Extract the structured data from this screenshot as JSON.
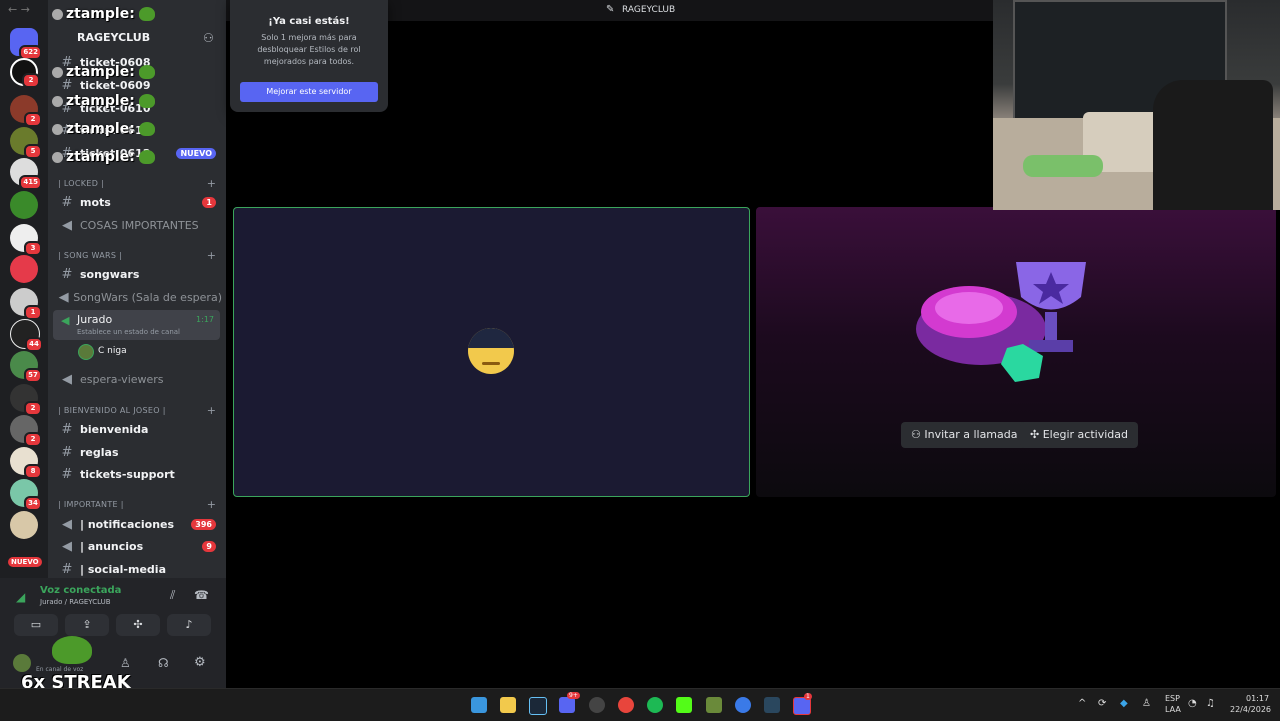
{
  "window": {
    "title": "RAGEYCLUB",
    "nav": "← →"
  },
  "server": {
    "name": "RAGEYCLUB"
  },
  "overlay": {
    "chat_user": "ztample:",
    "streak": "6x STREAK"
  },
  "channels_top": [
    {
      "name": "ticket-0608"
    },
    {
      "name": "ticket-0609"
    },
    {
      "name": "ticket-0610"
    },
    {
      "name": "ticket-0611"
    },
    {
      "name": "ticket-0612",
      "tag": "NUEVO"
    }
  ],
  "categories": {
    "locked": "| LOCKED |",
    "songwars": "| SONG WARS |",
    "bienvenida": "| BIENVENIDO AL JOSEO |",
    "importante": "| IMPORTANTE |"
  },
  "channels": {
    "mots": {
      "name": "mots",
      "badge": "1"
    },
    "cosas": {
      "name": "COSAS IMPORTANTES"
    },
    "songwars": {
      "name": "songwars"
    },
    "songwars_wait": {
      "name": "SongWars (Sala de espera)"
    },
    "jurado": {
      "name": "Jurado",
      "time": "1:17",
      "status": "Establece un estado de canal"
    },
    "jurado_user": {
      "name": "C niga"
    },
    "espera": {
      "name": "espera-viewers"
    },
    "bienvenida": {
      "name": "bienvenida"
    },
    "reglas": {
      "name": "reglas"
    },
    "tickets": {
      "name": "tickets-support"
    },
    "notificaciones": {
      "name": "| notificaciones",
      "badge": "396"
    },
    "anuncios": {
      "name": "| anuncios",
      "badge": "9"
    },
    "social": {
      "name": "| social-media"
    }
  },
  "rail_badges": [
    "622",
    "2",
    "2",
    "5",
    "415",
    "3",
    "1",
    "44",
    "57",
    "2",
    "2",
    "8",
    "34"
  ],
  "rail_new": "NUEVO",
  "voice": {
    "status": "Voz conectada",
    "location": "Jurado / RAGEYCLUB",
    "user_sub": "En canal de voz"
  },
  "popup": {
    "title": "¡Ya casi estás!",
    "body": "Solo 1 mejora más para desbloquear Estilos de rol mejorados para todos.",
    "button": "Mejorar este servidor"
  },
  "activity": {
    "invite": "Invitar a llamada",
    "choose": "Elegir actividad"
  },
  "taskbar": {
    "lang1": "ESP",
    "lang2": "LAA",
    "time": "01:17",
    "date": "22/4/2026",
    "discord_badge": "9+",
    "app_badge": "1"
  },
  "colors": {
    "accent": "#5865f2",
    "green": "#3ba55c",
    "danger": "#e5373c"
  }
}
